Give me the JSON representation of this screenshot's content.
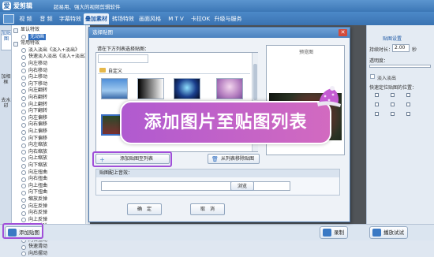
{
  "window": {
    "logo_char": "爱",
    "app_name": "爱剪辑",
    "slogan": "超易用、强大的视频剪辑软件"
  },
  "tabs": [
    {
      "label": "视 频"
    },
    {
      "label": "音 频"
    },
    {
      "label": "字幕特效"
    },
    {
      "label": "叠加素材",
      "active": true
    },
    {
      "label": "转场特效"
    },
    {
      "label": "画面风格"
    },
    {
      "label": "M T V"
    },
    {
      "label": "卡拉OK"
    },
    {
      "label": "升级与服务"
    }
  ],
  "left_side_tabs": [
    {
      "label": "加贴图",
      "active": true
    },
    {
      "label": "加相框"
    },
    {
      "label": "去水印"
    }
  ],
  "tree": {
    "groups": [
      {
        "label": "显认特效",
        "items": [
          {
            "label": "无动画",
            "selected": true
          }
        ]
      },
      {
        "label": "常用特效",
        "items": [
          {
            "label": "淡入淡出《淡入+淡出》"
          },
          {
            "label": "快速淡入淡出《淡入+淡出》"
          },
          {
            "label": "向左移动"
          },
          {
            "label": "向右移动"
          },
          {
            "label": "向上移动"
          },
          {
            "label": "向下移动"
          },
          {
            "label": "向左翻转"
          },
          {
            "label": "向右翻转"
          },
          {
            "label": "向上翻转"
          },
          {
            "label": "向下翻转"
          },
          {
            "label": "向左偏移"
          },
          {
            "label": "向右偏移"
          },
          {
            "label": "向上偏移"
          },
          {
            "label": "向下偏移"
          },
          {
            "label": "向左缩放"
          },
          {
            "label": "向右缩放"
          },
          {
            "label": "向上缩放"
          },
          {
            "label": "向下缩放"
          },
          {
            "label": "向左扭曲"
          },
          {
            "label": "向右扭曲"
          },
          {
            "label": "向上扭曲"
          },
          {
            "label": "向下扭曲"
          },
          {
            "label": "缩放反弹"
          },
          {
            "label": "向左反弹"
          },
          {
            "label": "向右反弹"
          },
          {
            "label": "向上反弹"
          },
          {
            "label": "向下反弹"
          },
          {
            "label": "向左摆动"
          },
          {
            "label": "向右摆动"
          },
          {
            "label": "快速滑动"
          },
          {
            "label": "向后摆动"
          }
        ]
      }
    ]
  },
  "bottom": {
    "add_sticker": "添加贴图",
    "export_label": "录制",
    "fade_label": "播放试试"
  },
  "dialog": {
    "title": "选择贴图",
    "close_glyph": "✕",
    "hint": "请在下方列表选择贴图：",
    "folder_label": "自定义",
    "preview_label": "预览图",
    "add_to_list": "添加贴图至列表",
    "remove_from_list": "从列表移除贴图",
    "audio_header": "贴图配上音效：",
    "browse": "浏览",
    "ok": "确　定",
    "cancel": "取　消"
  },
  "right_panel": {
    "section_title": "贴图设置",
    "duration_label": "持续时长：",
    "duration_value": "2.00",
    "duration_unit": "秒",
    "opacity_label": "透明度：",
    "fade_label": "淡入淡出",
    "position_label": "快速定位贴图的位置："
  },
  "banner": {
    "text": "添加图片至贴图列表"
  },
  "colors": {
    "accent": "#3c77b6",
    "highlight": "#a04fd9",
    "banner": "#c562c8"
  }
}
